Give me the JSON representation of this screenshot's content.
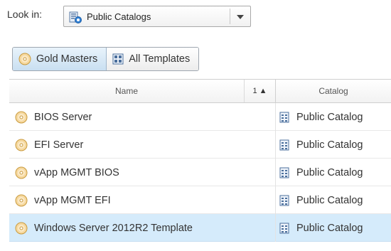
{
  "look_in": {
    "label": "Look in:",
    "selected": "Public Catalogs"
  },
  "view_toggle": {
    "gold_masters": "Gold Masters",
    "all_templates": "All Templates"
  },
  "grid": {
    "columns": {
      "name": "Name",
      "sort": "1 ▲",
      "catalog": "Catalog"
    },
    "rows": [
      {
        "name": "BIOS Server",
        "catalog": "Public Catalog"
      },
      {
        "name": "EFI Server",
        "catalog": "Public Catalog"
      },
      {
        "name": "vApp MGMT BIOS",
        "catalog": "Public Catalog"
      },
      {
        "name": "vApp MGMT EFI",
        "catalog": "Public Catalog"
      },
      {
        "name": "Windows Server 2012R2 Template",
        "catalog": "Public Catalog"
      }
    ]
  },
  "icons": {
    "template": "disc-icon",
    "catalog": "catalog-icon",
    "grid": "grid-icon"
  },
  "colors": {
    "selected_row": "#d5ebfb",
    "active_toggle": "#c9dff1"
  }
}
